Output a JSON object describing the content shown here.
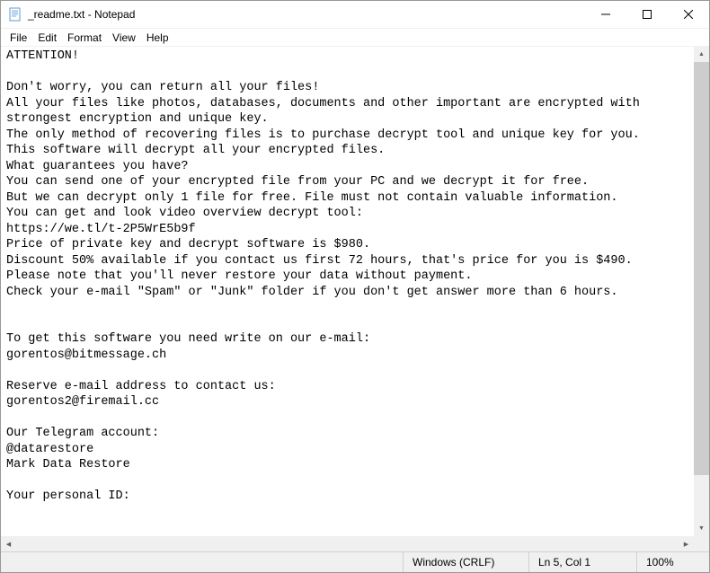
{
  "window": {
    "title": "_readme.txt - Notepad"
  },
  "menubar": {
    "file": "File",
    "edit": "Edit",
    "format": "Format",
    "view": "View",
    "help": "Help"
  },
  "content": {
    "text": "ATTENTION!\n\nDon't worry, you can return all your files!\nAll your files like photos, databases, documents and other important are encrypted with strongest encryption and unique key.\nThe only method of recovering files is to purchase decrypt tool and unique key for you.\nThis software will decrypt all your encrypted files.\nWhat guarantees you have?\nYou can send one of your encrypted file from your PC and we decrypt it for free.\nBut we can decrypt only 1 file for free. File must not contain valuable information.\nYou can get and look video overview decrypt tool:\nhttps://we.tl/t-2P5WrE5b9f\nPrice of private key and decrypt software is $980.\nDiscount 50% available if you contact us first 72 hours, that's price for you is $490.\nPlease note that you'll never restore your data without payment.\nCheck your e-mail \"Spam\" or \"Junk\" folder if you don't get answer more than 6 hours.\n\n\nTo get this software you need write on our e-mail:\ngorentos@bitmessage.ch\n\nReserve e-mail address to contact us:\ngorentos2@firemail.cc\n\nOur Telegram account:\n@datarestore\nMark Data Restore\n\nYour personal ID:\n"
  },
  "statusbar": {
    "encoding": "Windows (CRLF)",
    "position": "Ln 5, Col 1",
    "zoom": "100%"
  }
}
